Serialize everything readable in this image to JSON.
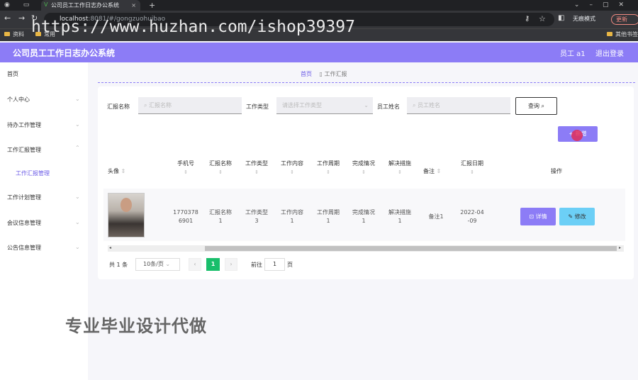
{
  "browser": {
    "tab_title": "公司员工工作日志办公系统",
    "url_host": "localhost",
    "url_path": ":8081/#/gongzuohuibao",
    "incognito": "无痕模式",
    "update": "更新",
    "bookmarks": [
      "资料",
      "常用"
    ],
    "other_bookmarks": "其他书签",
    "watermark": "https://www.huzhan.com/ishop39397"
  },
  "header": {
    "title": "公司员工工作日志办公系统",
    "user": "员工 a1",
    "logout": "退出登录"
  },
  "sidebar": {
    "items": [
      "首页",
      "个人中心",
      "待办工作管理",
      "工作汇报管理",
      "工作计划管理",
      "会议信息管理",
      "公告信息管理"
    ],
    "sub_item": "工作汇报管理"
  },
  "breadcrumb": {
    "home": "首页",
    "current": "工作汇报"
  },
  "search": {
    "report_label": "汇报名称",
    "report_placeholder": "汇报名称",
    "type_label": "工作类型",
    "type_placeholder": "请选择工作类型",
    "name_label": "员工姓名",
    "name_placeholder": "员工姓名",
    "query": "查询"
  },
  "add_button": "+ 新增",
  "table": {
    "headers": [
      "头像",
      "手机号",
      "汇报名称",
      "工作类型",
      "工作内容",
      "工作周期",
      "完成情况",
      "解决措施",
      "备注",
      "汇报日期",
      "操作"
    ],
    "row": {
      "phone_1": "1770378",
      "phone_2": "6901",
      "report_1": "汇报名称",
      "report_2": "1",
      "type_1": "工作类型",
      "type_2": "3",
      "content_1": "工作内容",
      "content_2": "1",
      "period_1": "工作周期",
      "period_2": "1",
      "done_1": "完成情况",
      "done_2": "1",
      "measure_1": "解决措施",
      "measure_2": "1",
      "note": "备注1",
      "date_1": "2022-04",
      "date_2": "-09"
    },
    "detail": "详情",
    "edit": "修改"
  },
  "pager": {
    "total": "共 1 条",
    "size": "10条/页",
    "current": "1",
    "goto": "前往",
    "goto_value": "1",
    "page": "页"
  },
  "promo": "专业毕业设计代做"
}
